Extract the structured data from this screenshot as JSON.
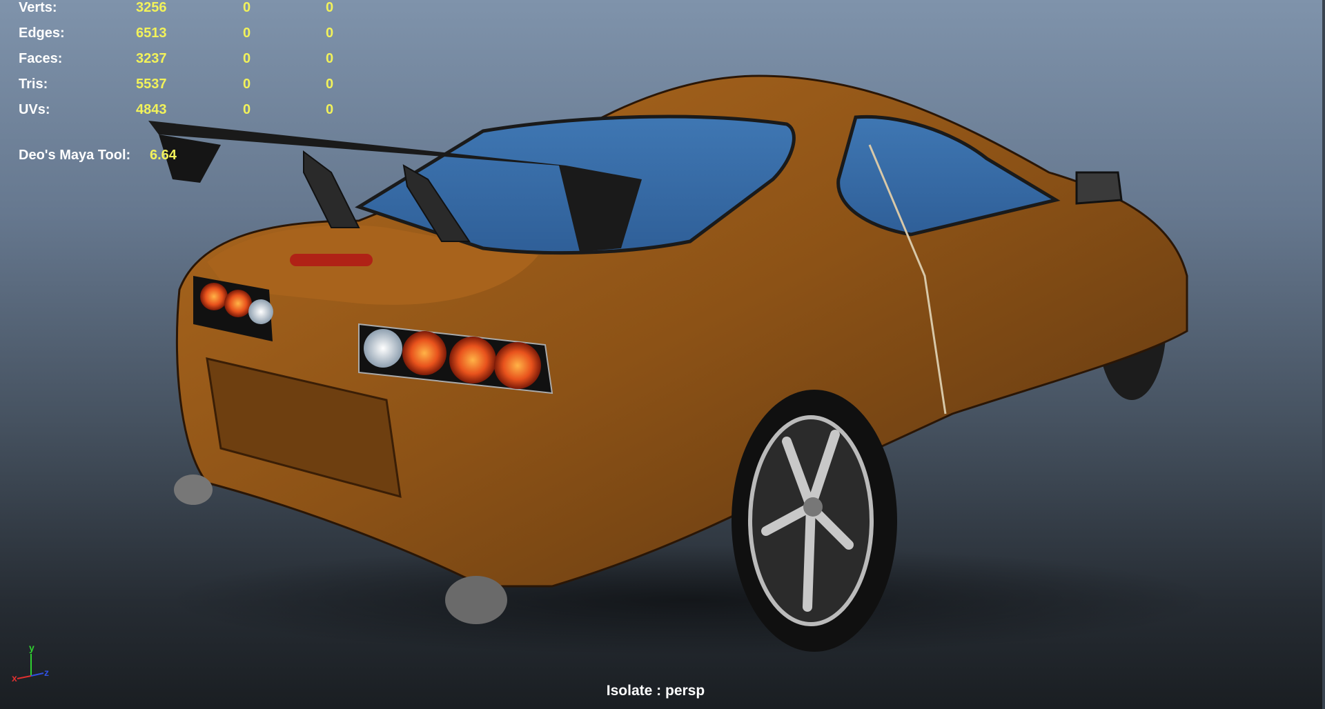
{
  "hud": {
    "stats": [
      {
        "label": "Verts:",
        "v1": "3256",
        "v2": "0",
        "v3": "0"
      },
      {
        "label": "Edges:",
        "v1": "6513",
        "v2": "0",
        "v3": "0"
      },
      {
        "label": "Faces:",
        "v1": "3237",
        "v2": "0",
        "v3": "0"
      },
      {
        "label": "Tris:",
        "v1": "5537",
        "v2": "0",
        "v3": "0"
      },
      {
        "label": "UVs:",
        "v1": "4843",
        "v2": "0",
        "v3": "0"
      }
    ],
    "tool_label": "Deo's Maya Tool:",
    "tool_value": "6.64"
  },
  "viewport": {
    "label": "Isolate : persp"
  },
  "axis": {
    "x": "x",
    "y": "y",
    "z": "z"
  },
  "colors": {
    "body": "#9a5a18",
    "glass": "#3a6ea8",
    "hud_value": "#f2f25a"
  }
}
